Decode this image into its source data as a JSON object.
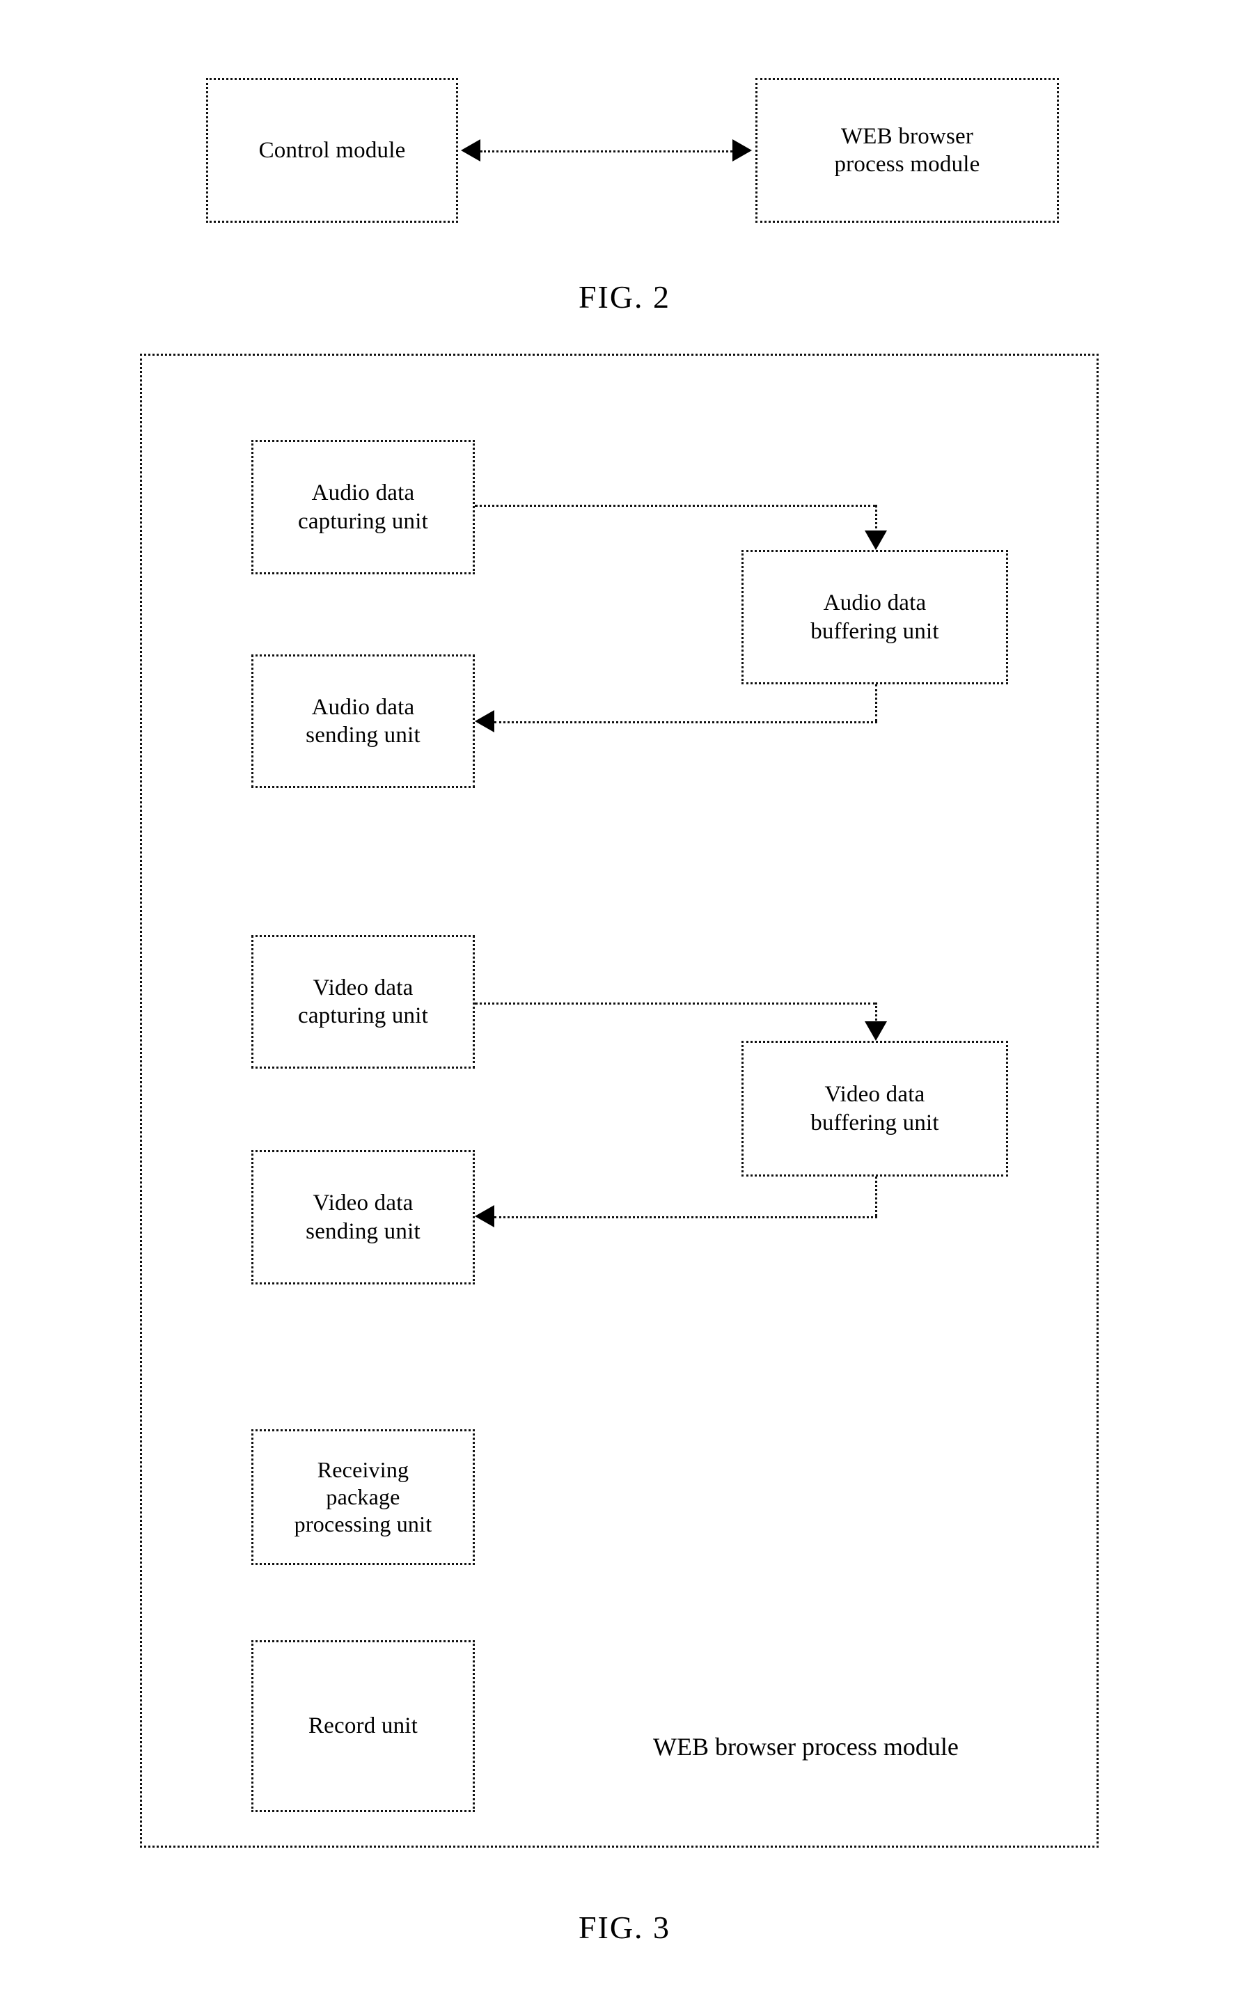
{
  "figures": [
    {
      "id": "fig2",
      "caption": "FIG. 2",
      "boxes": [
        {
          "name": "control-module",
          "label": "Control module"
        },
        {
          "name": "web-browser-process-module",
          "label": "WEB browser\nprocess module"
        }
      ],
      "connectors": [
        {
          "name": "control-module-to-web-browser-process-module",
          "style": "dotted",
          "direction": "bidirectional"
        }
      ]
    },
    {
      "id": "fig3",
      "caption": "FIG. 3",
      "container_label": "WEB browser process module",
      "boxes": [
        {
          "name": "audio-data-capturing-unit",
          "label": "Audio data\ncapturing unit"
        },
        {
          "name": "audio-data-buffering-unit",
          "label": "Audio data\nbuffering unit"
        },
        {
          "name": "audio-data-sending-unit",
          "label": "Audio data\nsending unit"
        },
        {
          "name": "video-data-capturing-unit",
          "label": "Video data\ncapturing unit"
        },
        {
          "name": "video-data-buffering-unit",
          "label": "Video data\nbuffering unit"
        },
        {
          "name": "video-data-sending-unit",
          "label": "Video data\nsending unit"
        },
        {
          "name": "receiving-package-processing-unit",
          "label": "Receiving\npackage\nprocessing unit"
        },
        {
          "name": "record-unit",
          "label": "Record unit"
        }
      ],
      "connectors": [
        {
          "name": "audio-capturing-to-audio-buffering",
          "style": "dotted",
          "direction": "down"
        },
        {
          "name": "audio-buffering-to-audio-sending",
          "style": "dotted",
          "direction": "left"
        },
        {
          "name": "video-capturing-to-video-buffering",
          "style": "dotted",
          "direction": "down"
        },
        {
          "name": "video-buffering-to-video-sending",
          "style": "dotted",
          "direction": "left"
        }
      ]
    }
  ],
  "colors": {
    "ink": "#111111",
    "background": "#ffffff"
  }
}
